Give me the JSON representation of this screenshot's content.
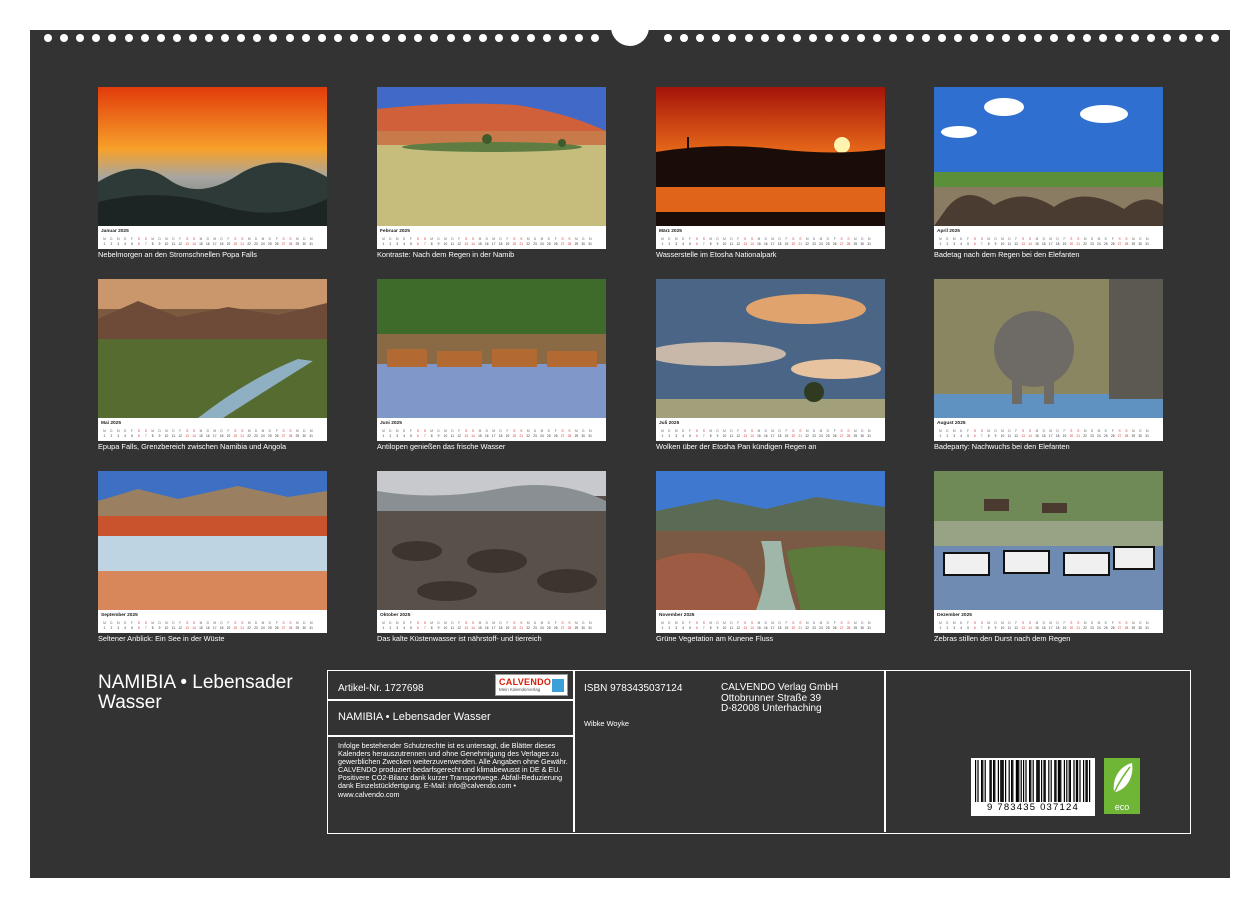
{
  "months": [
    {
      "month": "Januar 2025",
      "caption": "Nebelmorgen an den Stromschnellen Popa Falls",
      "scene": "mist-sunrise"
    },
    {
      "month": "Februar 2025",
      "caption": "Kontraste: Nach dem Regen in der Namib",
      "scene": "dune-lake"
    },
    {
      "month": "März 2025",
      "caption": "Wasserstelle im Etosha Nationalpark",
      "scene": "sunset-waterhole"
    },
    {
      "month": "April 2025",
      "caption": "Badetag nach dem Regen bei den Elefanten",
      "scene": "elephants-sky"
    },
    {
      "month": "Mai 2025",
      "caption": "Epupa Falls, Grenzbereich zwischen Namibia und Angola",
      "scene": "river-valley"
    },
    {
      "month": "Juni 2025",
      "caption": "Antilopen genießen das frische Wasser",
      "scene": "antelopes"
    },
    {
      "month": "Juli 2025",
      "caption": "Wolken über der Etosha Pan kündigen Regen an",
      "scene": "clouds-pan"
    },
    {
      "month": "August 2025",
      "caption": "Badeparty: Nachwuchs bei den Elefanten",
      "scene": "baby-elephant"
    },
    {
      "month": "September 2025",
      "caption": "Seltener Anblick: Ein See in der Wüste",
      "scene": "desert-lake"
    },
    {
      "month": "Oktober 2025",
      "caption": "Das kalte Küstenwasser ist nährstoff- und tierreich",
      "scene": "seal-colony"
    },
    {
      "month": "November 2025",
      "caption": "Grüne Vegetation am Kunene Fluss",
      "scene": "kunene-gorge"
    },
    {
      "month": "Dezember 2025",
      "caption": "Zebras stillen den Durst nach dem Regen",
      "scene": "zebras"
    }
  ],
  "weekday_letters": [
    "M",
    "D",
    "M",
    "D",
    "F",
    "S",
    "S",
    "M",
    "D",
    "M",
    "D",
    "F",
    "S",
    "S",
    "M",
    "D",
    "M",
    "D",
    "F",
    "S",
    "S",
    "M",
    "D",
    "M",
    "D",
    "F",
    "S",
    "S",
    "M",
    "D",
    "M"
  ],
  "day_numbers": [
    "1",
    "2",
    "3",
    "4",
    "5",
    "6",
    "7",
    "8",
    "9",
    "10",
    "11",
    "12",
    "13",
    "14",
    "15",
    "16",
    "17",
    "18",
    "19",
    "20",
    "21",
    "22",
    "23",
    "24",
    "25",
    "26",
    "27",
    "28",
    "29",
    "30",
    "31"
  ],
  "footer": {
    "title_line1": "NAMIBIA • Lebensader",
    "title_line2": "Wasser",
    "article": "Artikel-Nr. 1727698",
    "logo_name": "CALVENDO",
    "logo_sub": "Mein Kalenderverlag",
    "product_title": "NAMIBIA • Lebensader Wasser",
    "legal": "Infolge bestehender Schutzrechte ist es untersagt, die Blätter dieses Kalenders herauszutrennen und ohne Genehmigung des Verlages zu gewerblichen Zwecken weiterzuverwenden. Alle Angaben ohne Gewähr. CALVENDO produziert bedarfsgerecht und klimabewusst in DE & EU. Positivere CO2-Bilanz dank kurzer Transportwege. Abfall-Reduzierung dank Einzelstückfertigung. E-Mail: info@calvendo.com • www.calvendo.com",
    "isbn": "ISBN 9783435037124",
    "author": "Wibke Woyke",
    "publisher_name": "CALVENDO Verlag GmbH",
    "publisher_street": "Ottobrunner Straße 39",
    "publisher_city": "D-82008 Unterhaching",
    "ean": "9 783435 037124",
    "eco_label": "eco"
  },
  "colors": {
    "page_bg": "#333333",
    "weekend_red": "#d33333",
    "eco_green": "#6fb536",
    "calvendo_red": "#d81e05"
  }
}
